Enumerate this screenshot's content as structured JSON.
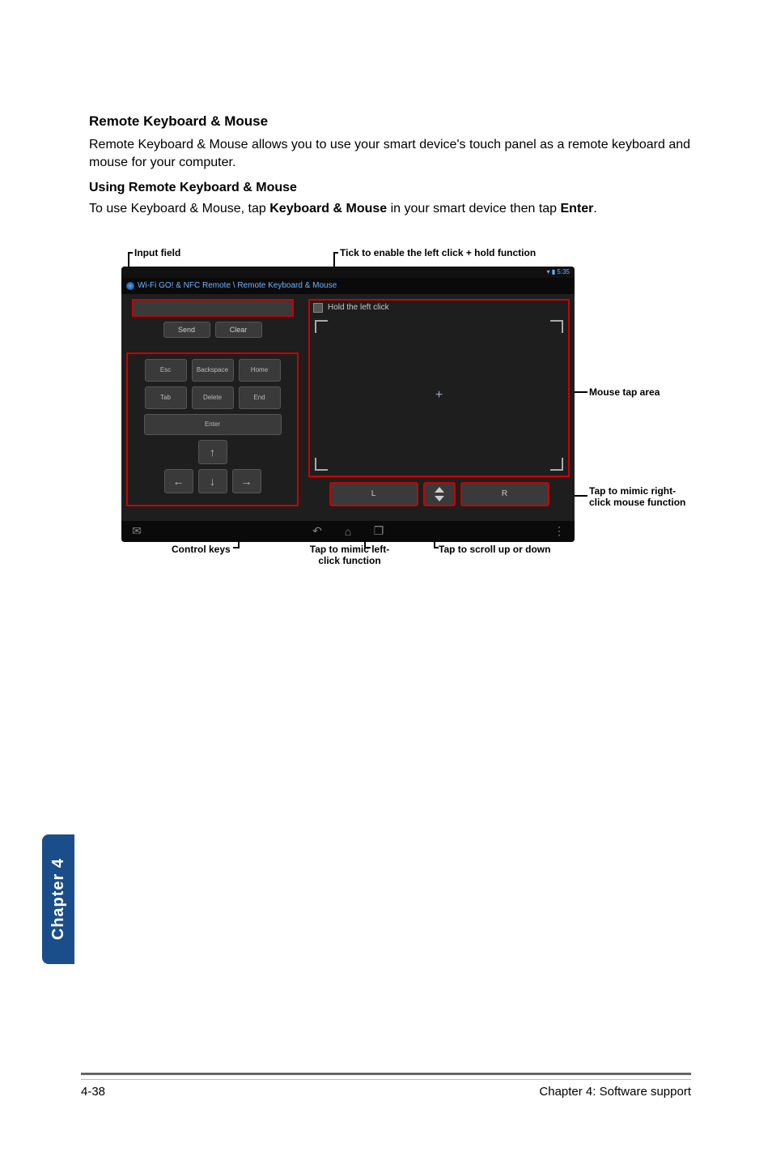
{
  "section_title": "Remote Keyboard & Mouse",
  "section_intro": "Remote Keyboard & Mouse allows you to use your smart device's touch panel as a remote keyboard and mouse for your computer.",
  "subsection_title": "Using Remote Keyboard & Mouse",
  "subsection_intro_parts": {
    "a": "To use Keyboard & Mouse, tap ",
    "b_bold": "Keyboard & Mouse",
    "c": " in your smart device then tap ",
    "d_bold": "Enter",
    "e": "."
  },
  "callouts": {
    "input_field": "Input field",
    "tick_hold": "Tick to enable the left click + hold function",
    "mouse_tap_area": "Mouse tap area",
    "right_click": "Tap to mimic right-click mouse function",
    "control_keys": "Control keys",
    "left_click": "Tap to mimic left-click function",
    "scroll": "Tap to scroll up or down"
  },
  "device": {
    "status_time": "5:35",
    "title": "Wi-Fi GO! & NFC Remote \\ Remote Keyboard & Mouse",
    "buttons": {
      "send": "Send",
      "clear": "Clear"
    },
    "keys": {
      "esc": "Esc",
      "backspace": "Backspace",
      "home": "Home",
      "tab": "Tab",
      "delete": "Delete",
      "end": "End",
      "enter": "Enter"
    },
    "hold_label": "Hold the left click",
    "mouse_buttons": {
      "left": "L",
      "right": "R"
    }
  },
  "side_tab": "Chapter 4",
  "footer": {
    "page": "4-38",
    "chapter": "Chapter 4: Software support"
  }
}
